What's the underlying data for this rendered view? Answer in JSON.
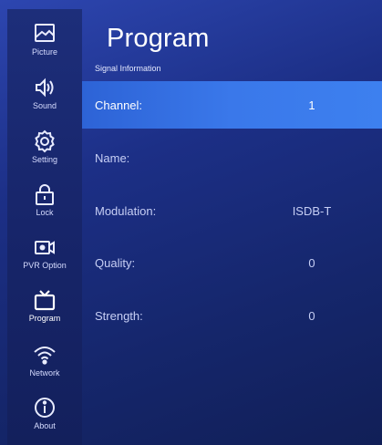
{
  "header": {
    "title": "Program",
    "subtitle": "Signal Information"
  },
  "sidebar": {
    "items": [
      {
        "label": "Picture",
        "icon": "picture-icon"
      },
      {
        "label": "Sound",
        "icon": "speaker-icon"
      },
      {
        "label": "Setting",
        "icon": "gear-icon"
      },
      {
        "label": "Lock",
        "icon": "lock-icon"
      },
      {
        "label": "PVR Option",
        "icon": "record-camera-icon"
      },
      {
        "label": "Program",
        "icon": "tv-icon",
        "active": true
      },
      {
        "label": "Network",
        "icon": "wifi-icon"
      },
      {
        "label": "About",
        "icon": "info-icon"
      }
    ]
  },
  "signal_info": {
    "rows": [
      {
        "label": "Channel:",
        "value": "1",
        "selected": true
      },
      {
        "label": "Name:",
        "value": ""
      },
      {
        "label": "Modulation:",
        "value": "ISDB-T"
      },
      {
        "label": "Quality:",
        "value": "0"
      },
      {
        "label": "Strength:",
        "value": "0"
      }
    ]
  },
  "colors": {
    "background": "#1c2f86",
    "sidebar": "#17256a",
    "highlight": "#3a78ea",
    "text": "#ffffff",
    "muted_text": "#c7cff5"
  }
}
